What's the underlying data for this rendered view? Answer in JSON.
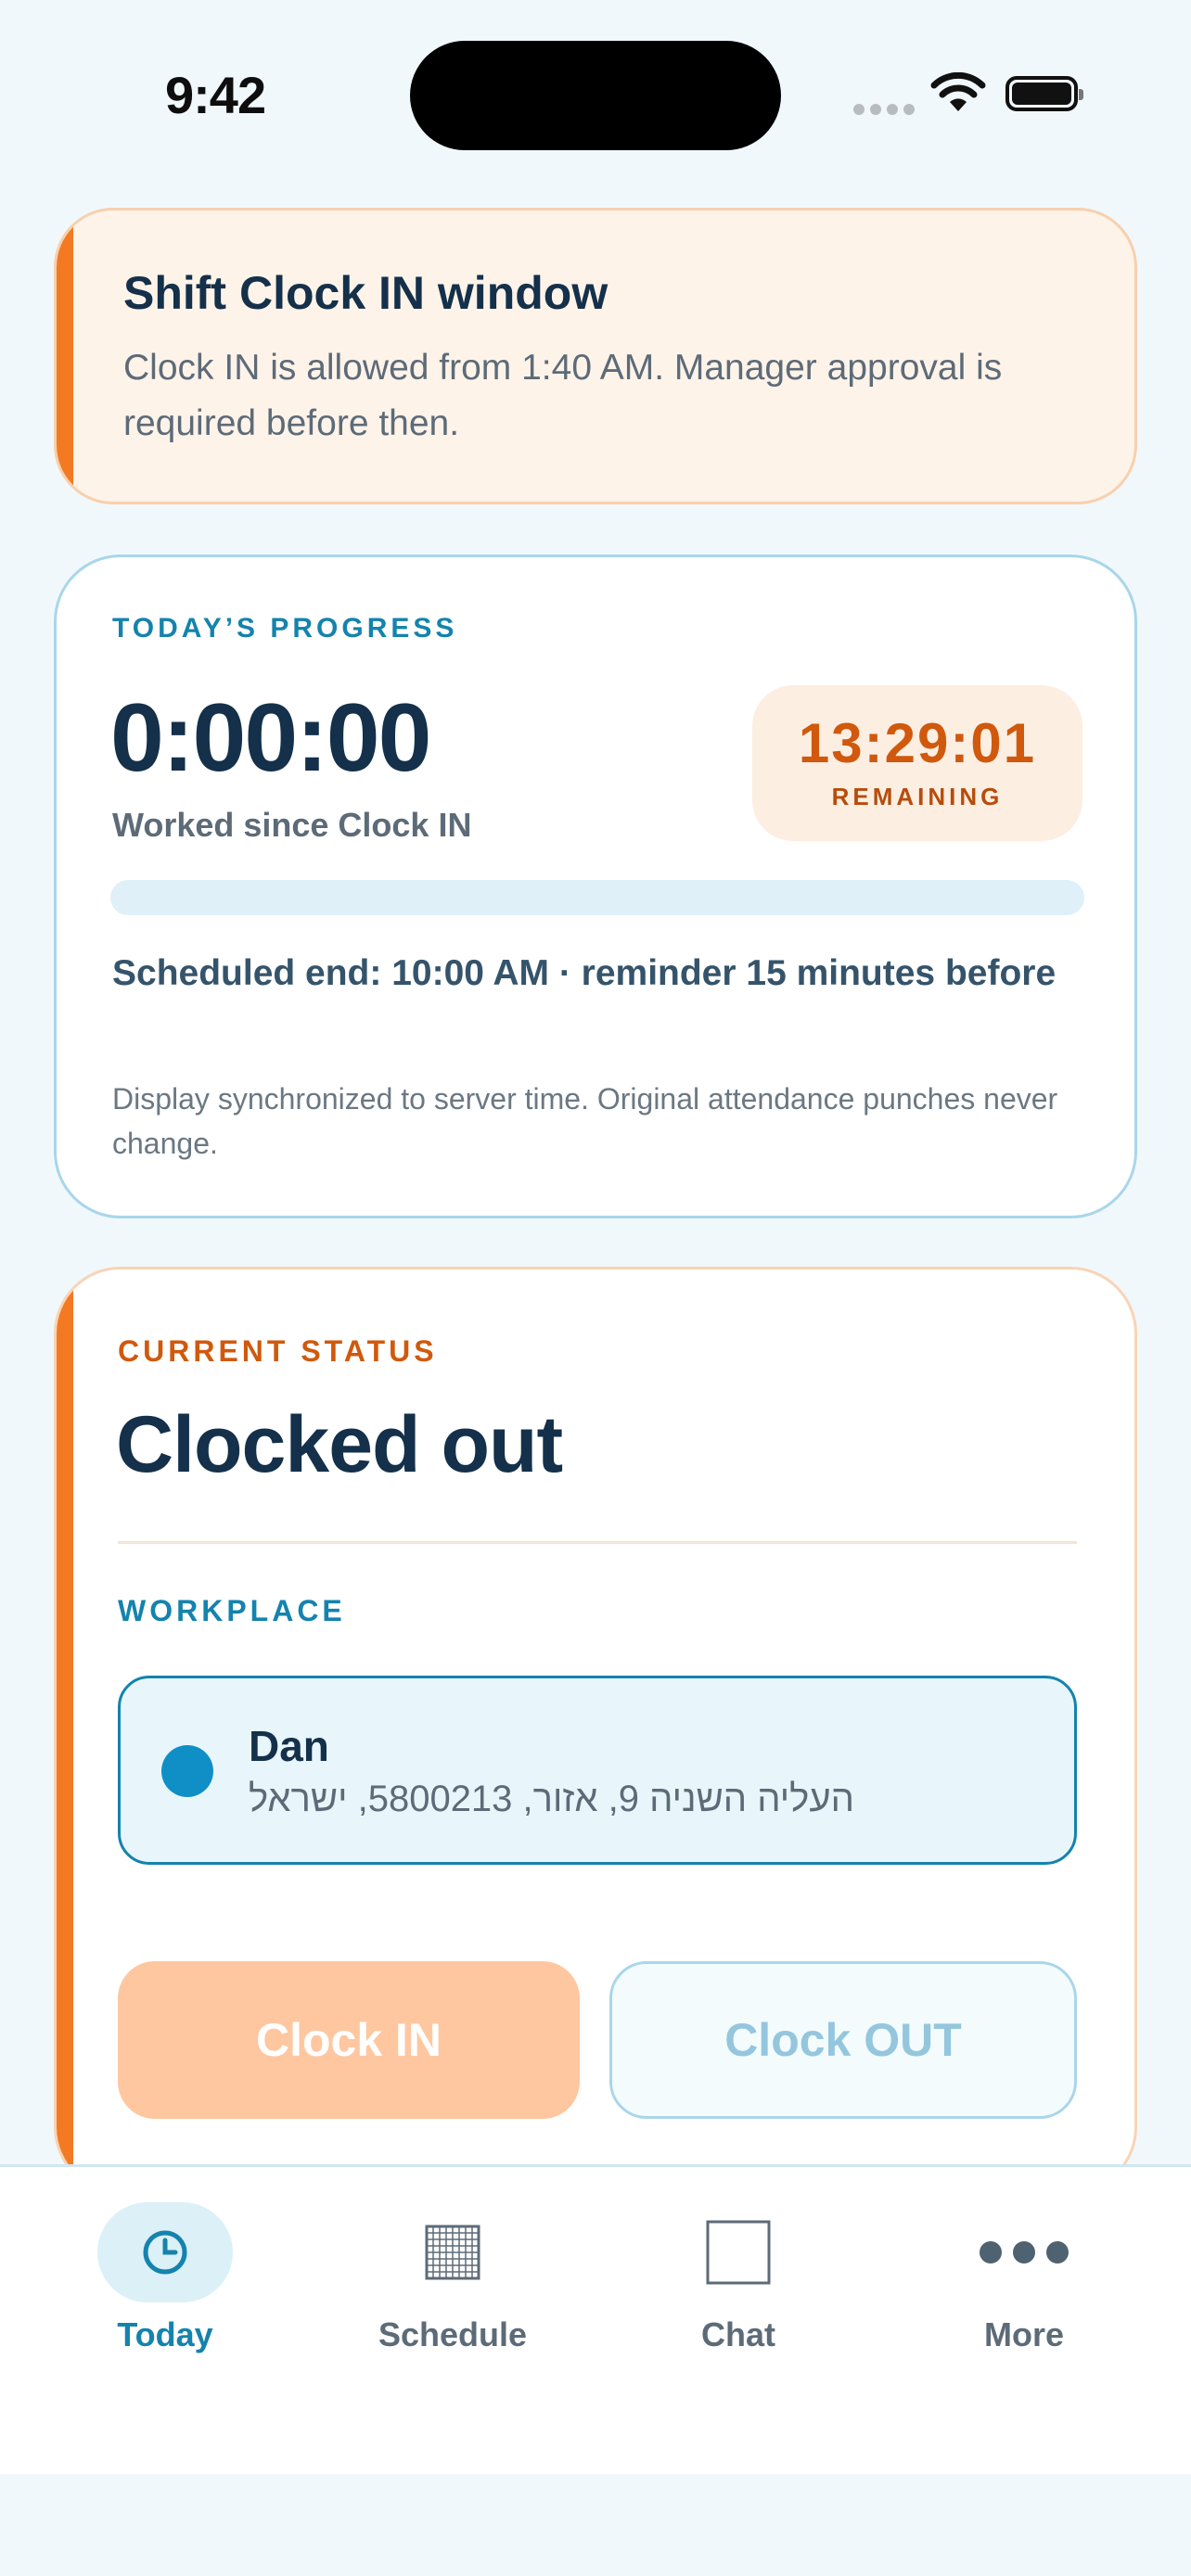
{
  "status_bar": {
    "time": "9:42"
  },
  "banner": {
    "title": "Shift Clock IN window",
    "text": "Clock IN is allowed from 1:40 AM. Manager approval is required before then."
  },
  "progress": {
    "label": "TODAY’S PROGRESS",
    "elapsed": "0:00:00",
    "elapsed_caption": "Worked since Clock IN",
    "remaining_time": "13:29:01",
    "remaining_label": "REMAINING",
    "fraction_complete": 0,
    "scheduled_end": "Scheduled end: 10:00 AM · reminder 15 minutes before",
    "sync_note": "Display synchronized to server time. Original attendance punches never change."
  },
  "status": {
    "label": "CURRENT STATUS",
    "state": "Clocked out",
    "workplace_label": "WORKPLACE",
    "workplace": {
      "name": "Dan",
      "address": "העליה השניה 9, אזור, 5800213, ישראל"
    },
    "clock_in_label": "Clock IN",
    "clock_out_label": "Clock OUT"
  },
  "tabs": [
    {
      "label": "Today",
      "icon": "clock-icon",
      "active": true
    },
    {
      "label": "Schedule",
      "icon": "calendar-grid-icon",
      "active": false
    },
    {
      "label": "Chat",
      "icon": "chat-icon",
      "active": false
    },
    {
      "label": "More",
      "icon": "more-icon",
      "active": false
    }
  ],
  "colors": {
    "accent_orange": "#f37a22",
    "accent_blue": "#1483ad",
    "text_dark": "#14304a"
  }
}
